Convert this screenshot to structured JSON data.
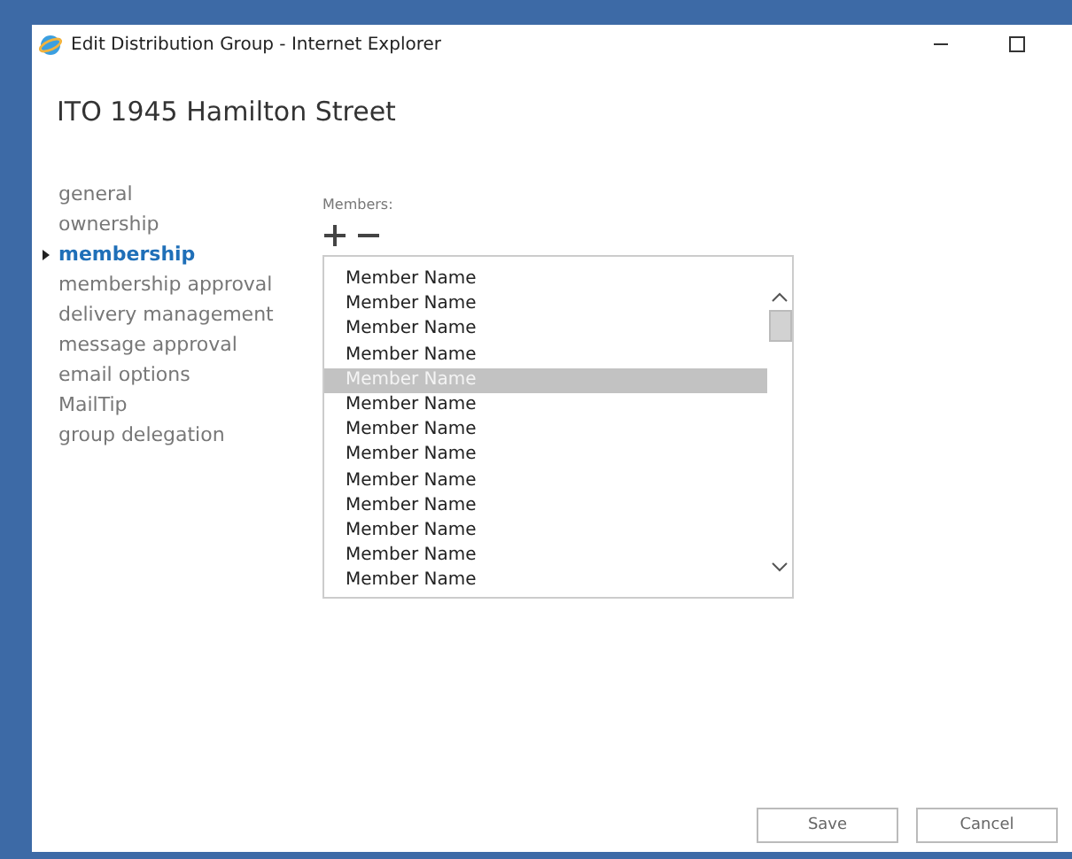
{
  "window": {
    "title": "Edit Distribution Group - Internet Explorer"
  },
  "heading": "ITO 1945 Hamilton Street",
  "sidebar": {
    "items": [
      {
        "label": "general",
        "selected": false
      },
      {
        "label": "ownership",
        "selected": false
      },
      {
        "label": "membership",
        "selected": true
      },
      {
        "label": "membership approval",
        "selected": false
      },
      {
        "label": "delivery management",
        "selected": false
      },
      {
        "label": "message approval",
        "selected": false
      },
      {
        "label": "email options",
        "selected": false
      },
      {
        "label": "MailTip",
        "selected": false
      },
      {
        "label": "group delegation",
        "selected": false
      }
    ]
  },
  "members": {
    "label": "Members:",
    "rows": [
      {
        "name": "Member Name",
        "selected": false
      },
      {
        "name": "Member Name",
        "selected": false
      },
      {
        "name": "Member Name",
        "selected": false
      },
      {
        "name": "Member Name",
        "selected": false
      },
      {
        "name": "Member Name",
        "selected": true
      },
      {
        "name": "Member Name",
        "selected": false
      },
      {
        "name": "Member Name",
        "selected": false
      },
      {
        "name": "Member Name",
        "selected": false
      },
      {
        "name": "Member Name",
        "selected": false
      },
      {
        "name": "Member Name",
        "selected": false
      },
      {
        "name": "Member Name",
        "selected": false
      },
      {
        "name": "Member Name",
        "selected": false
      },
      {
        "name": "Member Name",
        "selected": false
      }
    ]
  },
  "buttons": [
    "Save",
    "Cancel"
  ]
}
